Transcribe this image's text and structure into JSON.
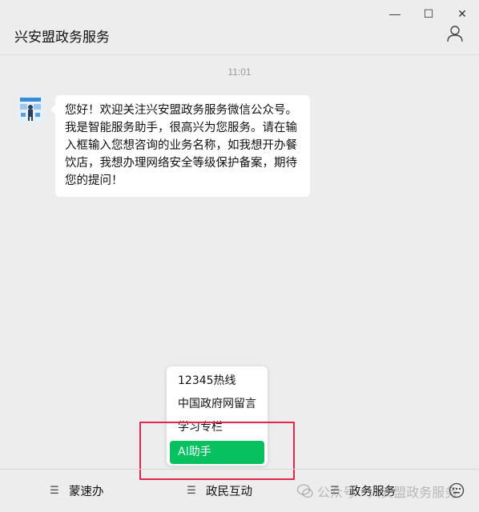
{
  "window": {
    "controls": [
      "minimize-icon",
      "maximize-icon",
      "close-icon"
    ],
    "minimize_glyph": "—",
    "maximize_glyph": "☐",
    "close_glyph": "✕"
  },
  "header": {
    "title": "兴安盟政务服务",
    "profile_icon": "person-icon"
  },
  "chat": {
    "timestamp": "11:01",
    "avatar_icon": "account-avatar",
    "message": "您好！欢迎关注兴安盟政务服务微信公众号。我是智能服务助手，很高兴为您服务。请在输入框输入您想咨询的业务名称，如我想开办餐饮店，我想办理网络安全等级保护备案，期待您的提问！"
  },
  "popup_menu": {
    "items": [
      {
        "label": "12345热线",
        "active": false
      },
      {
        "label": "中国政府网留言",
        "active": false
      },
      {
        "label": "学习专栏",
        "active": false
      },
      {
        "label": "AI助手",
        "active": true
      }
    ]
  },
  "bottom_menu": {
    "items": [
      {
        "label": "蒙速办",
        "icon": "menu-lines-icon"
      },
      {
        "label": "政民互动",
        "icon": "menu-lines-icon"
      },
      {
        "label": "政务服务",
        "icon": "menu-lines-icon"
      }
    ],
    "menu_glyph": "☰",
    "keyboard_icon": "keyboard-icon"
  },
  "watermark": {
    "text": "公众号 · 兴安盟政务服务"
  },
  "colors": {
    "accent": "#07c160",
    "highlight": "#e0264a",
    "background": "#ededed"
  }
}
